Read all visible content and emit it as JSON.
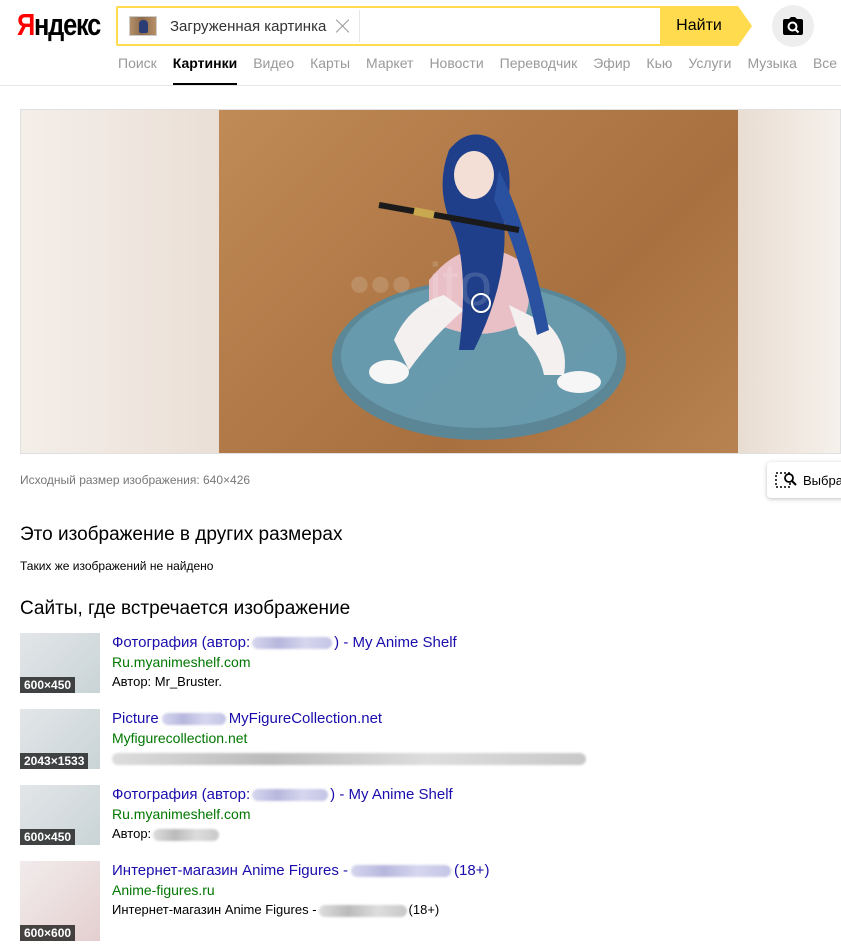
{
  "logo": {
    "first": "Я",
    "rest": "ндекс"
  },
  "search": {
    "chip_label": "Загруженная картинка",
    "button_label": "Найти"
  },
  "nav": {
    "tabs": [
      "Поиск",
      "Картинки",
      "Видео",
      "Карты",
      "Маркет",
      "Новости",
      "Переводчик",
      "Эфир",
      "Кью",
      "Услуги",
      "Музыка",
      "Все"
    ],
    "active_index": 1
  },
  "image": {
    "original_size": "Исходный размер изображения: 640×426",
    "select_label": "Выбрать фрагмент"
  },
  "sizes_section": {
    "heading": "Это изображение в других размерах",
    "empty_text": "Таких же изображений не найдено"
  },
  "sites_section": {
    "heading": "Сайты, где встречается изображение",
    "results": [
      {
        "size": "600×450",
        "title_start": "Фотография (автор:",
        "title_end": ") - My Anime Shelf",
        "url": "Ru.myanimeshelf.com",
        "desc": "Автор: Mr_Bruster."
      },
      {
        "size": "2043×1533",
        "title_start": "Picture",
        "title_end": "MyFigureCollection.net",
        "url": "Myfigurecollection.net",
        "desc": ""
      },
      {
        "size": "600×450",
        "title_start": "Фотография (автор:",
        "title_end": ") - My Anime Shelf",
        "url": "Ru.myanimeshelf.com",
        "desc": "Автор:"
      },
      {
        "size": "600×600",
        "title_start": "Интернет-магазин Anime Figures -",
        "title_end": "(18+)",
        "url": "Anime-figures.ru",
        "desc": "Интернет-магазин Anime Figures -",
        "desc_end": "(18+)"
      }
    ]
  }
}
